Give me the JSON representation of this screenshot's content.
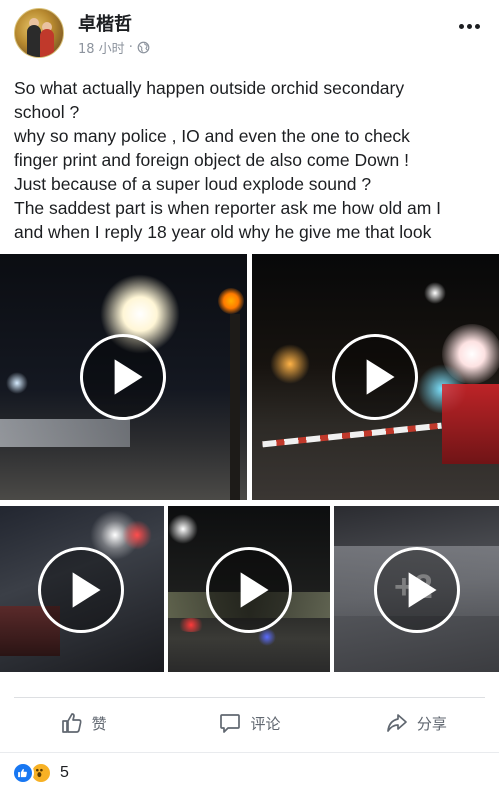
{
  "post": {
    "author": "卓楷哲",
    "time": "18 小时",
    "separator": "·",
    "privacy_icon": "globe-icon",
    "more_icon": "more-dots-icon",
    "text_lines": [
      "So what actually happen outside orchid secondary",
      "school ?",
      "why so many police , IO and even the one to check",
      "finger print and foreign object de also come Down !",
      "Just because of a super loud explode sound ?",
      "The saddest part is when reporter ask me how old am I",
      "and when I reply 18 year old why he give me that look"
    ]
  },
  "media": {
    "tiles": [
      {
        "name": "video-1",
        "type": "video"
      },
      {
        "name": "video-2",
        "type": "video"
      },
      {
        "name": "video-3",
        "type": "video"
      },
      {
        "name": "video-4",
        "type": "video"
      },
      {
        "name": "video-5",
        "type": "video",
        "more_count": "+2"
      }
    ]
  },
  "actions": {
    "like_label": "赞",
    "comment_label": "评论",
    "share_label": "分享"
  },
  "reactions": {
    "icons": [
      "like-reaction-icon",
      "wow-reaction-icon"
    ],
    "count": "5"
  },
  "colors": {
    "like_blue": "#1877f2",
    "wow_yellow": "#f7b125",
    "meta_gray": "#8d949e",
    "action_gray": "#606770"
  }
}
